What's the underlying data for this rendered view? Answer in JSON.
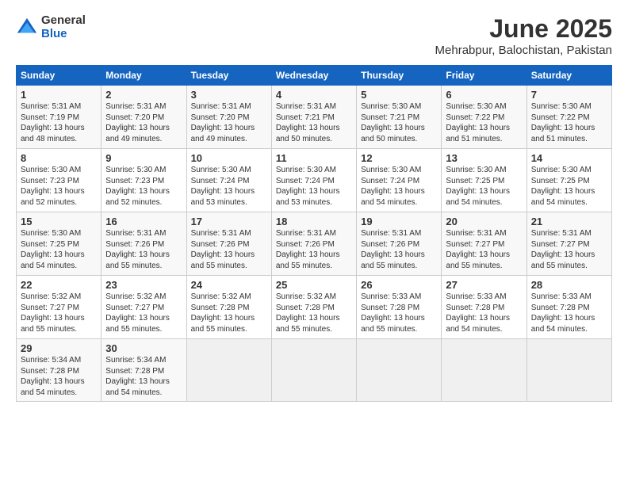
{
  "logo": {
    "general": "General",
    "blue": "Blue"
  },
  "title": "June 2025",
  "subtitle": "Mehrabpur, Balochistan, Pakistan",
  "headers": [
    "Sunday",
    "Monday",
    "Tuesday",
    "Wednesday",
    "Thursday",
    "Friday",
    "Saturday"
  ],
  "weeks": [
    [
      {
        "day": "1",
        "sunrise": "5:31 AM",
        "sunset": "7:19 PM",
        "daylight": "13 hours and 48 minutes."
      },
      {
        "day": "2",
        "sunrise": "5:31 AM",
        "sunset": "7:20 PM",
        "daylight": "13 hours and 49 minutes."
      },
      {
        "day": "3",
        "sunrise": "5:31 AM",
        "sunset": "7:20 PM",
        "daylight": "13 hours and 49 minutes."
      },
      {
        "day": "4",
        "sunrise": "5:31 AM",
        "sunset": "7:21 PM",
        "daylight": "13 hours and 50 minutes."
      },
      {
        "day": "5",
        "sunrise": "5:30 AM",
        "sunset": "7:21 PM",
        "daylight": "13 hours and 50 minutes."
      },
      {
        "day": "6",
        "sunrise": "5:30 AM",
        "sunset": "7:22 PM",
        "daylight": "13 hours and 51 minutes."
      },
      {
        "day": "7",
        "sunrise": "5:30 AM",
        "sunset": "7:22 PM",
        "daylight": "13 hours and 51 minutes."
      }
    ],
    [
      {
        "day": "8",
        "sunrise": "5:30 AM",
        "sunset": "7:23 PM",
        "daylight": "13 hours and 52 minutes."
      },
      {
        "day": "9",
        "sunrise": "5:30 AM",
        "sunset": "7:23 PM",
        "daylight": "13 hours and 52 minutes."
      },
      {
        "day": "10",
        "sunrise": "5:30 AM",
        "sunset": "7:24 PM",
        "daylight": "13 hours and 53 minutes."
      },
      {
        "day": "11",
        "sunrise": "5:30 AM",
        "sunset": "7:24 PM",
        "daylight": "13 hours and 53 minutes."
      },
      {
        "day": "12",
        "sunrise": "5:30 AM",
        "sunset": "7:24 PM",
        "daylight": "13 hours and 54 minutes."
      },
      {
        "day": "13",
        "sunrise": "5:30 AM",
        "sunset": "7:25 PM",
        "daylight": "13 hours and 54 minutes."
      },
      {
        "day": "14",
        "sunrise": "5:30 AM",
        "sunset": "7:25 PM",
        "daylight": "13 hours and 54 minutes."
      }
    ],
    [
      {
        "day": "15",
        "sunrise": "5:30 AM",
        "sunset": "7:25 PM",
        "daylight": "13 hours and 54 minutes."
      },
      {
        "day": "16",
        "sunrise": "5:31 AM",
        "sunset": "7:26 PM",
        "daylight": "13 hours and 55 minutes."
      },
      {
        "day": "17",
        "sunrise": "5:31 AM",
        "sunset": "7:26 PM",
        "daylight": "13 hours and 55 minutes."
      },
      {
        "day": "18",
        "sunrise": "5:31 AM",
        "sunset": "7:26 PM",
        "daylight": "13 hours and 55 minutes."
      },
      {
        "day": "19",
        "sunrise": "5:31 AM",
        "sunset": "7:26 PM",
        "daylight": "13 hours and 55 minutes."
      },
      {
        "day": "20",
        "sunrise": "5:31 AM",
        "sunset": "7:27 PM",
        "daylight": "13 hours and 55 minutes."
      },
      {
        "day": "21",
        "sunrise": "5:31 AM",
        "sunset": "7:27 PM",
        "daylight": "13 hours and 55 minutes."
      }
    ],
    [
      {
        "day": "22",
        "sunrise": "5:32 AM",
        "sunset": "7:27 PM",
        "daylight": "13 hours and 55 minutes."
      },
      {
        "day": "23",
        "sunrise": "5:32 AM",
        "sunset": "7:27 PM",
        "daylight": "13 hours and 55 minutes."
      },
      {
        "day": "24",
        "sunrise": "5:32 AM",
        "sunset": "7:28 PM",
        "daylight": "13 hours and 55 minutes."
      },
      {
        "day": "25",
        "sunrise": "5:32 AM",
        "sunset": "7:28 PM",
        "daylight": "13 hours and 55 minutes."
      },
      {
        "day": "26",
        "sunrise": "5:33 AM",
        "sunset": "7:28 PM",
        "daylight": "13 hours and 55 minutes."
      },
      {
        "day": "27",
        "sunrise": "5:33 AM",
        "sunset": "7:28 PM",
        "daylight": "13 hours and 54 minutes."
      },
      {
        "day": "28",
        "sunrise": "5:33 AM",
        "sunset": "7:28 PM",
        "daylight": "13 hours and 54 minutes."
      }
    ],
    [
      {
        "day": "29",
        "sunrise": "5:34 AM",
        "sunset": "7:28 PM",
        "daylight": "13 hours and 54 minutes."
      },
      {
        "day": "30",
        "sunrise": "5:34 AM",
        "sunset": "7:28 PM",
        "daylight": "13 hours and 54 minutes."
      },
      null,
      null,
      null,
      null,
      null
    ]
  ]
}
